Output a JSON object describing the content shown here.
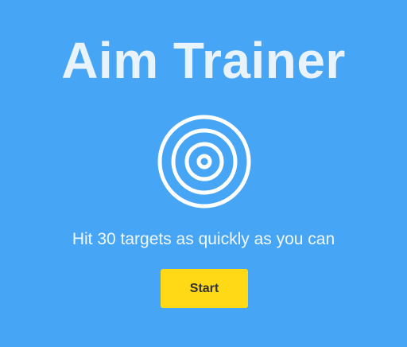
{
  "game": {
    "title": "Aim Trainer",
    "instructions": "Hit 30 targets as quickly as you can",
    "start_label": "Start",
    "icon": "target-icon"
  },
  "colors": {
    "background": "#47a5f6",
    "title": "#e9f3fc",
    "icon_stroke": "#ffffff",
    "button_bg": "#ffd916",
    "button_text": "#333333"
  }
}
